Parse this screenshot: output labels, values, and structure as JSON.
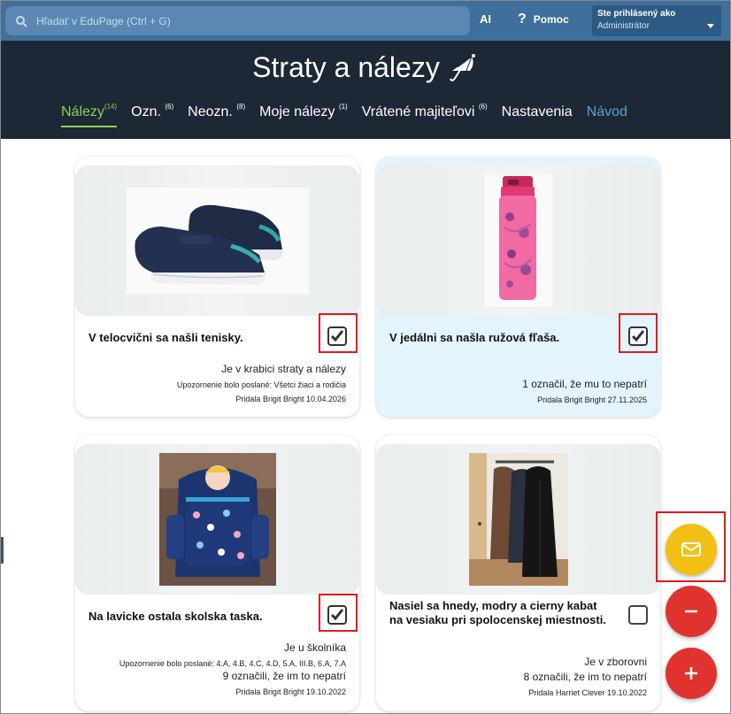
{
  "topbar": {
    "search_placeholder": "Hľadať v EduPage (Ctrl + G)",
    "ai_label": "AI",
    "help_label": "Pomoc",
    "user_line1": "Ste prihlásený ako",
    "user_line2": "Administrátor"
  },
  "header": {
    "title": "Straty a nálezy",
    "tabs": [
      {
        "label": "Nálezy",
        "count": "(14)"
      },
      {
        "label": "Ozn.",
        "count": "(6)"
      },
      {
        "label": "Neozn.",
        "count": "(8)"
      },
      {
        "label": "Moje nálezy",
        "count": "(1)"
      },
      {
        "label": "Vrátené majiteľovi",
        "count": "(6)"
      },
      {
        "label": "Nastavenia",
        "count": ""
      },
      {
        "label": "Návod",
        "count": ""
      }
    ]
  },
  "cards": [
    {
      "title": "V telocvični sa našli tenisky.",
      "location": "Je v krabici straty a nálezy",
      "notice": "Upozornenie bolo poslané: Všetci žiaci a rodičia",
      "marked": "",
      "added": "Pridala Brigit Bright 10.04.2026",
      "checked": true,
      "image_icon": "sneakers-image"
    },
    {
      "title": "V jedálni sa našla ružová fľaša.",
      "location": "",
      "notice": "",
      "marked": "1 označil, že mu to nepatrí",
      "added": "Pridala Brigit Bright 27.11.2025",
      "checked": true,
      "image_icon": "pink-bottle-image"
    },
    {
      "title": "Na lavicke ostala skolska taska.",
      "location": "Je u školníka",
      "notice": "Upozornenie bolo poslané: 4.A, 4.B, 4.C, 4.D, 5.A, III.B, 6.A, 7.A",
      "marked": "9 označili, že im to nepatrí",
      "added": "Pridala Brigit Bright 19.10.2022",
      "checked": true,
      "image_icon": "school-bag-image"
    },
    {
      "title": "Nasiel sa hnedy, modry a cierny kabat na vesiaku pri spolocenskej miestnosti.",
      "location": "Je v zborovni",
      "notice": "",
      "marked": "8 označili, že im to nepatrí",
      "added": "Pridala Harriet Clever 19.10.2022",
      "checked": false,
      "image_icon": "coats-image"
    }
  ],
  "colors": {
    "topbar": "#3f6f9c",
    "header": "#1c2836",
    "active_tab": "#8fd14f",
    "guide_tab": "#5b9fd6",
    "mail_fab": "#f2c012",
    "action_fab": "#e0332f",
    "highlight_box": "#e01b1b"
  }
}
